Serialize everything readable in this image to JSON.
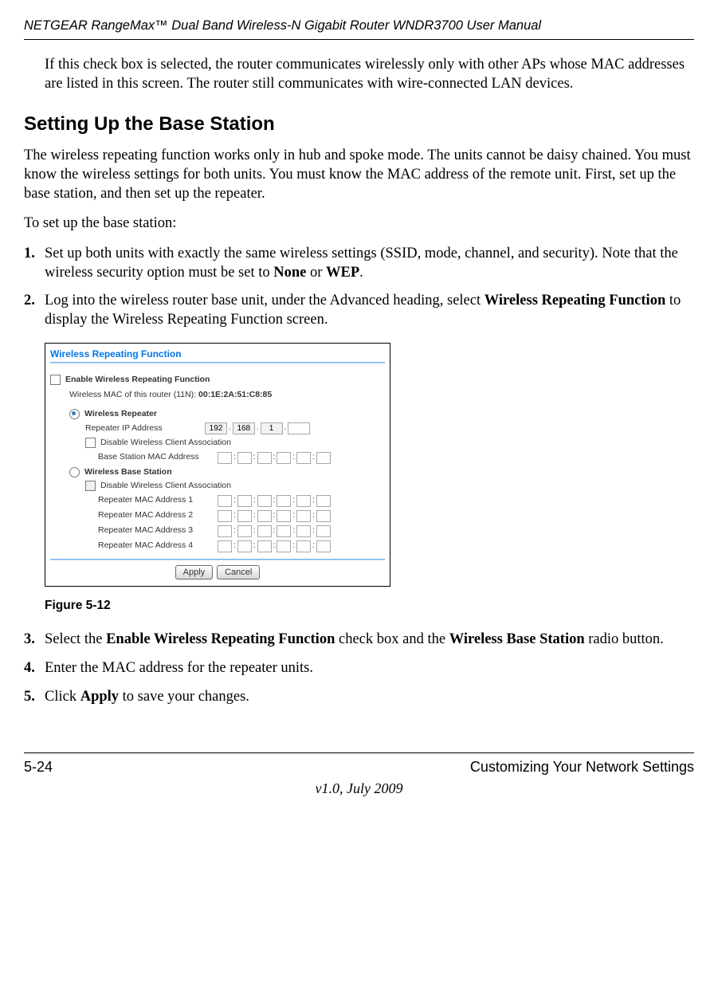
{
  "header": {
    "doc_title": "NETGEAR RangeMax™ Dual Band Wireless-N Gigabit Router WNDR3700 User Manual"
  },
  "intro": {
    "para1": "If this check box is selected, the router communicates wirelessly only with other APs whose MAC addresses are listed in this screen. The router still communicates with wire-connected LAN devices."
  },
  "section": {
    "heading": "Setting Up the Base Station",
    "para1": "The wireless repeating function works only in hub and spoke mode. The units cannot be daisy chained. You must know the wireless settings for both units. You must know the MAC address of the remote unit. First, set up the base station, and then set up the repeater.",
    "para2": "To set up the base station:"
  },
  "steps": {
    "s1": {
      "num": "1.",
      "text_pre": "Set up both units with exactly the same wireless settings (SSID, mode, channel, and security). Note that the wireless security option must be set to ",
      "bold1": "None",
      "mid": " or ",
      "bold2": "WEP",
      "tail": "."
    },
    "s2": {
      "num": "2.",
      "text_pre": "Log into the wireless router base unit, under the Advanced heading, select ",
      "bold1": "Wireless Repeating Function",
      "tail": " to display the Wireless Repeating Function screen."
    },
    "s3": {
      "num": "3.",
      "text_pre": "Select the ",
      "bold1": "Enable Wireless Repeating Function",
      "mid": " check box and the ",
      "bold2": "Wireless Base Station",
      "tail": " radio button."
    },
    "s4": {
      "num": "4.",
      "text": "Enter the MAC address for the repeater units."
    },
    "s5": {
      "num": "5.",
      "text_pre": "Click ",
      "bold1": "Apply",
      "tail": " to save your changes."
    }
  },
  "screenshot": {
    "title": "Wireless Repeating Function",
    "enable_label": "Enable Wireless Repeating Function",
    "mac_info_label": "Wireless MAC of this router (11N):",
    "mac_info_value": "00:1E:2A:51:C8:85",
    "repeater_label": "Wireless Repeater",
    "repeater_ip_label": "Repeater IP Address",
    "ip": {
      "a": "192",
      "b": "168",
      "c": "1",
      "d": ""
    },
    "disable_assoc_label": "Disable Wireless Client Association",
    "base_mac_label": "Base Station MAC Address",
    "base_station_label": "Wireless Base Station",
    "rep_mac1": "Repeater MAC Address 1",
    "rep_mac2": "Repeater MAC Address 2",
    "rep_mac3": "Repeater MAC Address 3",
    "rep_mac4": "Repeater MAC Address 4",
    "apply": "Apply",
    "cancel": "Cancel"
  },
  "figure_caption": "Figure 5-12",
  "footer": {
    "page": "5-24",
    "section": "Customizing Your Network Settings",
    "version": "v1.0, July 2009"
  }
}
